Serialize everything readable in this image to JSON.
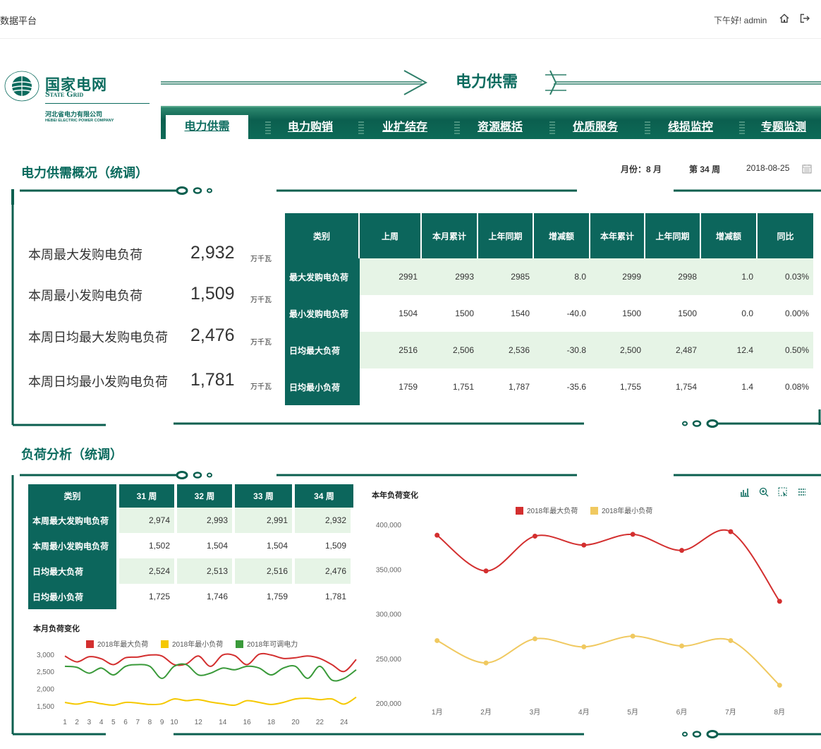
{
  "app": {
    "title": "数据平台",
    "greeting": "下午好! admin"
  },
  "logo": {
    "cn": "国家电网",
    "en": "State Grid",
    "sub_cn": "河北省电力有限公司",
    "sub_en": "HEBEI ELECTRIC POWER COMPANY"
  },
  "header": {
    "title": "电力供需"
  },
  "nav": {
    "tabs": [
      "电力供需",
      "电力购销",
      "业扩结存",
      "资源概括",
      "优质服务",
      "线损监控",
      "专题监测"
    ],
    "active": 0
  },
  "section1": {
    "title": "电力供需概况（统调）",
    "meta": {
      "month_label": "月份：",
      "month": "8",
      "month_unit": "月",
      "week_prefix": "第",
      "week": "34",
      "week_unit": "周",
      "date": "2018-08-25"
    },
    "kpis": [
      {
        "label": "本周最大发购电负荷",
        "value": "2,932",
        "unit": "万千瓦"
      },
      {
        "label": "本周最小发购电负荷",
        "value": "1,509",
        "unit": "万千瓦"
      },
      {
        "label": "本周日均最大发购电负荷",
        "value": "2,476",
        "unit": "万千瓦"
      },
      {
        "label": "本周日均最小发购电负荷",
        "value": "1,781",
        "unit": "万千瓦"
      }
    ],
    "table": {
      "headers": [
        "类别",
        "上周",
        "本月累计",
        "上年同期",
        "增减额",
        "本年累计",
        "上年同期",
        "增减额",
        "同比"
      ],
      "rows": [
        [
          "最大发购电负荷",
          "2991",
          "2993",
          "2985",
          "8.0",
          "2999",
          "2998",
          "1.0",
          "0.03%"
        ],
        [
          "最小发购电负荷",
          "1504",
          "1500",
          "1540",
          "-40.0",
          "1500",
          "1500",
          "0.0",
          "0.00%"
        ],
        [
          "日均最大负荷",
          "2516",
          "2,506",
          "2,536",
          "-30.8",
          "2,500",
          "2,487",
          "12.4",
          "0.50%"
        ],
        [
          "日均最小负荷",
          "1759",
          "1,751",
          "1,787",
          "-35.6",
          "1,755",
          "1,754",
          "1.4",
          "0.08%"
        ]
      ]
    }
  },
  "section2": {
    "title": "负荷分析（统调）",
    "table": {
      "headers": [
        "类别",
        "31 周",
        "32 周",
        "33 周",
        "34 周"
      ],
      "rows": [
        [
          "本周最大发购电负荷",
          "2,974",
          "2,993",
          "2,991",
          "2,932"
        ],
        [
          "本周最小发购电负荷",
          "1,502",
          "1,504",
          "1,504",
          "1,509"
        ],
        [
          "日均最大负荷",
          "2,524",
          "2,513",
          "2,516",
          "2,476"
        ],
        [
          "日均最小负荷",
          "1,725",
          "1,746",
          "1,759",
          "1,781"
        ]
      ]
    }
  },
  "chart_data": [
    {
      "type": "line",
      "title": "本月负荷变化",
      "x": [
        1,
        2,
        3,
        4,
        5,
        6,
        7,
        8,
        9,
        10,
        11,
        12,
        13,
        14,
        15,
        16,
        17,
        18,
        19,
        20,
        21,
        22,
        23,
        24,
        25
      ],
      "x_ticks": [
        "1",
        "2",
        "3",
        "4",
        "5",
        "6",
        "7",
        "8",
        "9",
        "10",
        "12",
        "14",
        "16",
        "18",
        "20",
        "22",
        "24"
      ],
      "ylim": [
        1250,
        3100
      ],
      "y_ticks": [
        "3,000",
        "2,500",
        "2,000",
        "1,500"
      ],
      "colors": [
        "#d32f2f",
        "#f5c800",
        "#3a9a3a"
      ],
      "legend_position": "top",
      "series": [
        {
          "name": "2018年最大负荷",
          "values": [
            2950,
            2780,
            2930,
            2870,
            2700,
            2900,
            2920,
            2980,
            2950,
            2700,
            2720,
            2950,
            2650,
            2980,
            2960,
            2700,
            3000,
            2980,
            2880,
            2900,
            2950,
            2880,
            2700,
            2500,
            2850
          ]
        },
        {
          "name": "2018年最小负荷",
          "values": [
            1600,
            1550,
            1620,
            1560,
            1520,
            1600,
            1580,
            1540,
            1560,
            1700,
            1650,
            1680,
            1610,
            1560,
            1520,
            1650,
            1600,
            1540,
            1600,
            1700,
            1720,
            1680,
            1700,
            1550,
            1750
          ]
        },
        {
          "name": "2018年可调电力",
          "values": [
            2650,
            2620,
            2450,
            2600,
            2400,
            2650,
            2700,
            2650,
            2300,
            2650,
            2700,
            2400,
            2450,
            2600,
            2550,
            2650,
            2600,
            2400,
            2600,
            2650,
            2300,
            2650,
            2250,
            2300,
            2550
          ]
        }
      ]
    },
    {
      "type": "line",
      "title": "本年负荷变化",
      "categories": [
        "1月",
        "2月",
        "3月",
        "4月",
        "5月",
        "6月",
        "7月",
        "8月"
      ],
      "ylim": [
        200000,
        400000
      ],
      "y_ticks": [
        "400,000",
        "350,000",
        "300,000",
        "250,000",
        "200,000"
      ],
      "colors": [
        "#d32f2f",
        "#f0c960"
      ],
      "legend_position": "top",
      "series": [
        {
          "name": "2018年最大负荷",
          "values": [
            388000,
            348000,
            387000,
            377000,
            389000,
            371000,
            392000,
            314000
          ]
        },
        {
          "name": "2018年最小负荷",
          "values": [
            270000,
            245000,
            272000,
            263000,
            275000,
            264000,
            270000,
            220000
          ]
        }
      ]
    }
  ]
}
